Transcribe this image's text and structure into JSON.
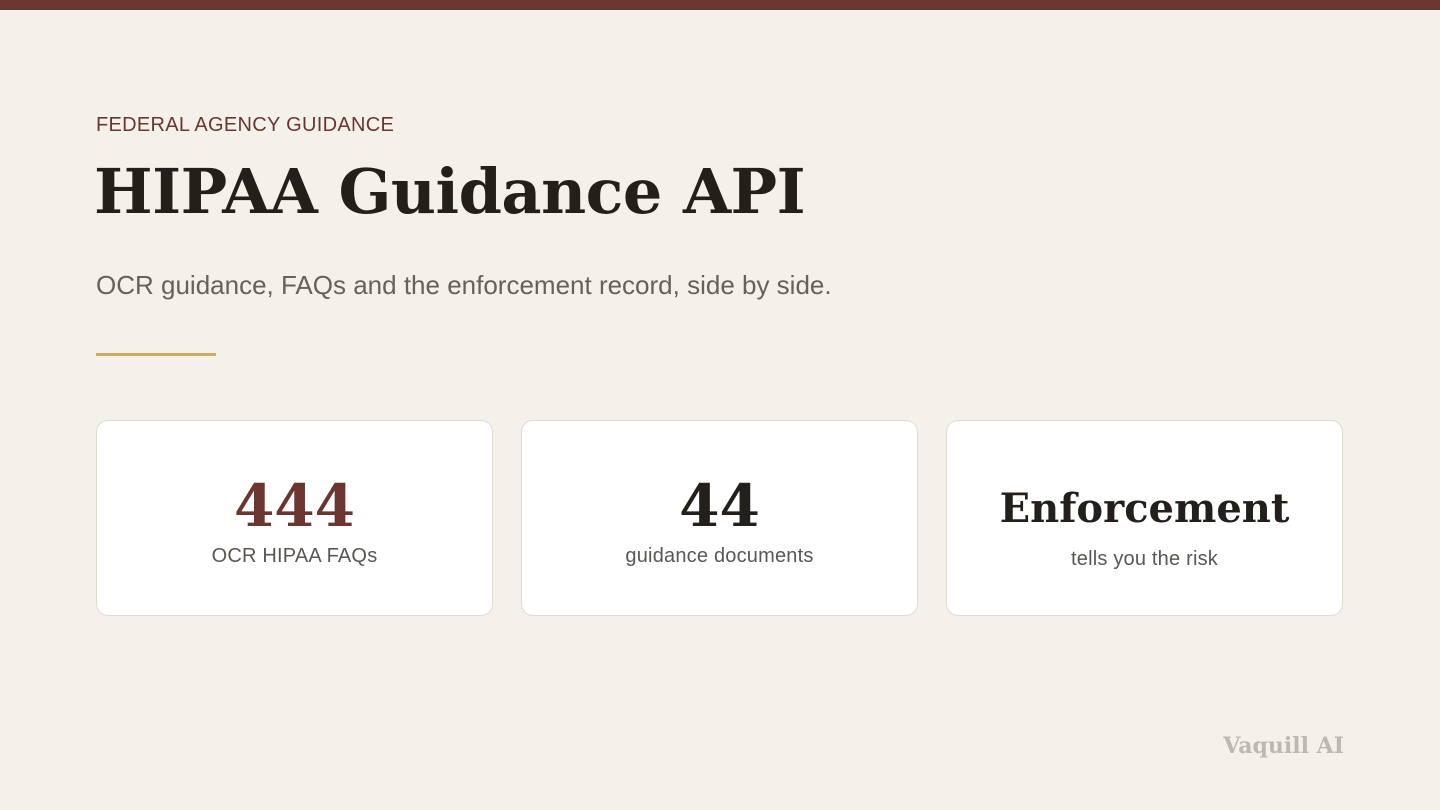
{
  "header": {
    "eyebrow": "FEDERAL AGENCY GUIDANCE",
    "title": "HIPAA Guidance API",
    "subtitle": "OCR guidance, FAQs and the enforcement record, side by side."
  },
  "stats": [
    {
      "value": "444",
      "label": "OCR HIPAA FAQs"
    },
    {
      "value": "44",
      "label": "guidance documents"
    },
    {
      "value": "Enforcement",
      "label": "tells you the risk"
    }
  ],
  "footer": {
    "brand": "Vaquill AI"
  },
  "colors": {
    "accent": "#6b3530",
    "divider": "#d1a967",
    "background": "#f4f1eb"
  }
}
